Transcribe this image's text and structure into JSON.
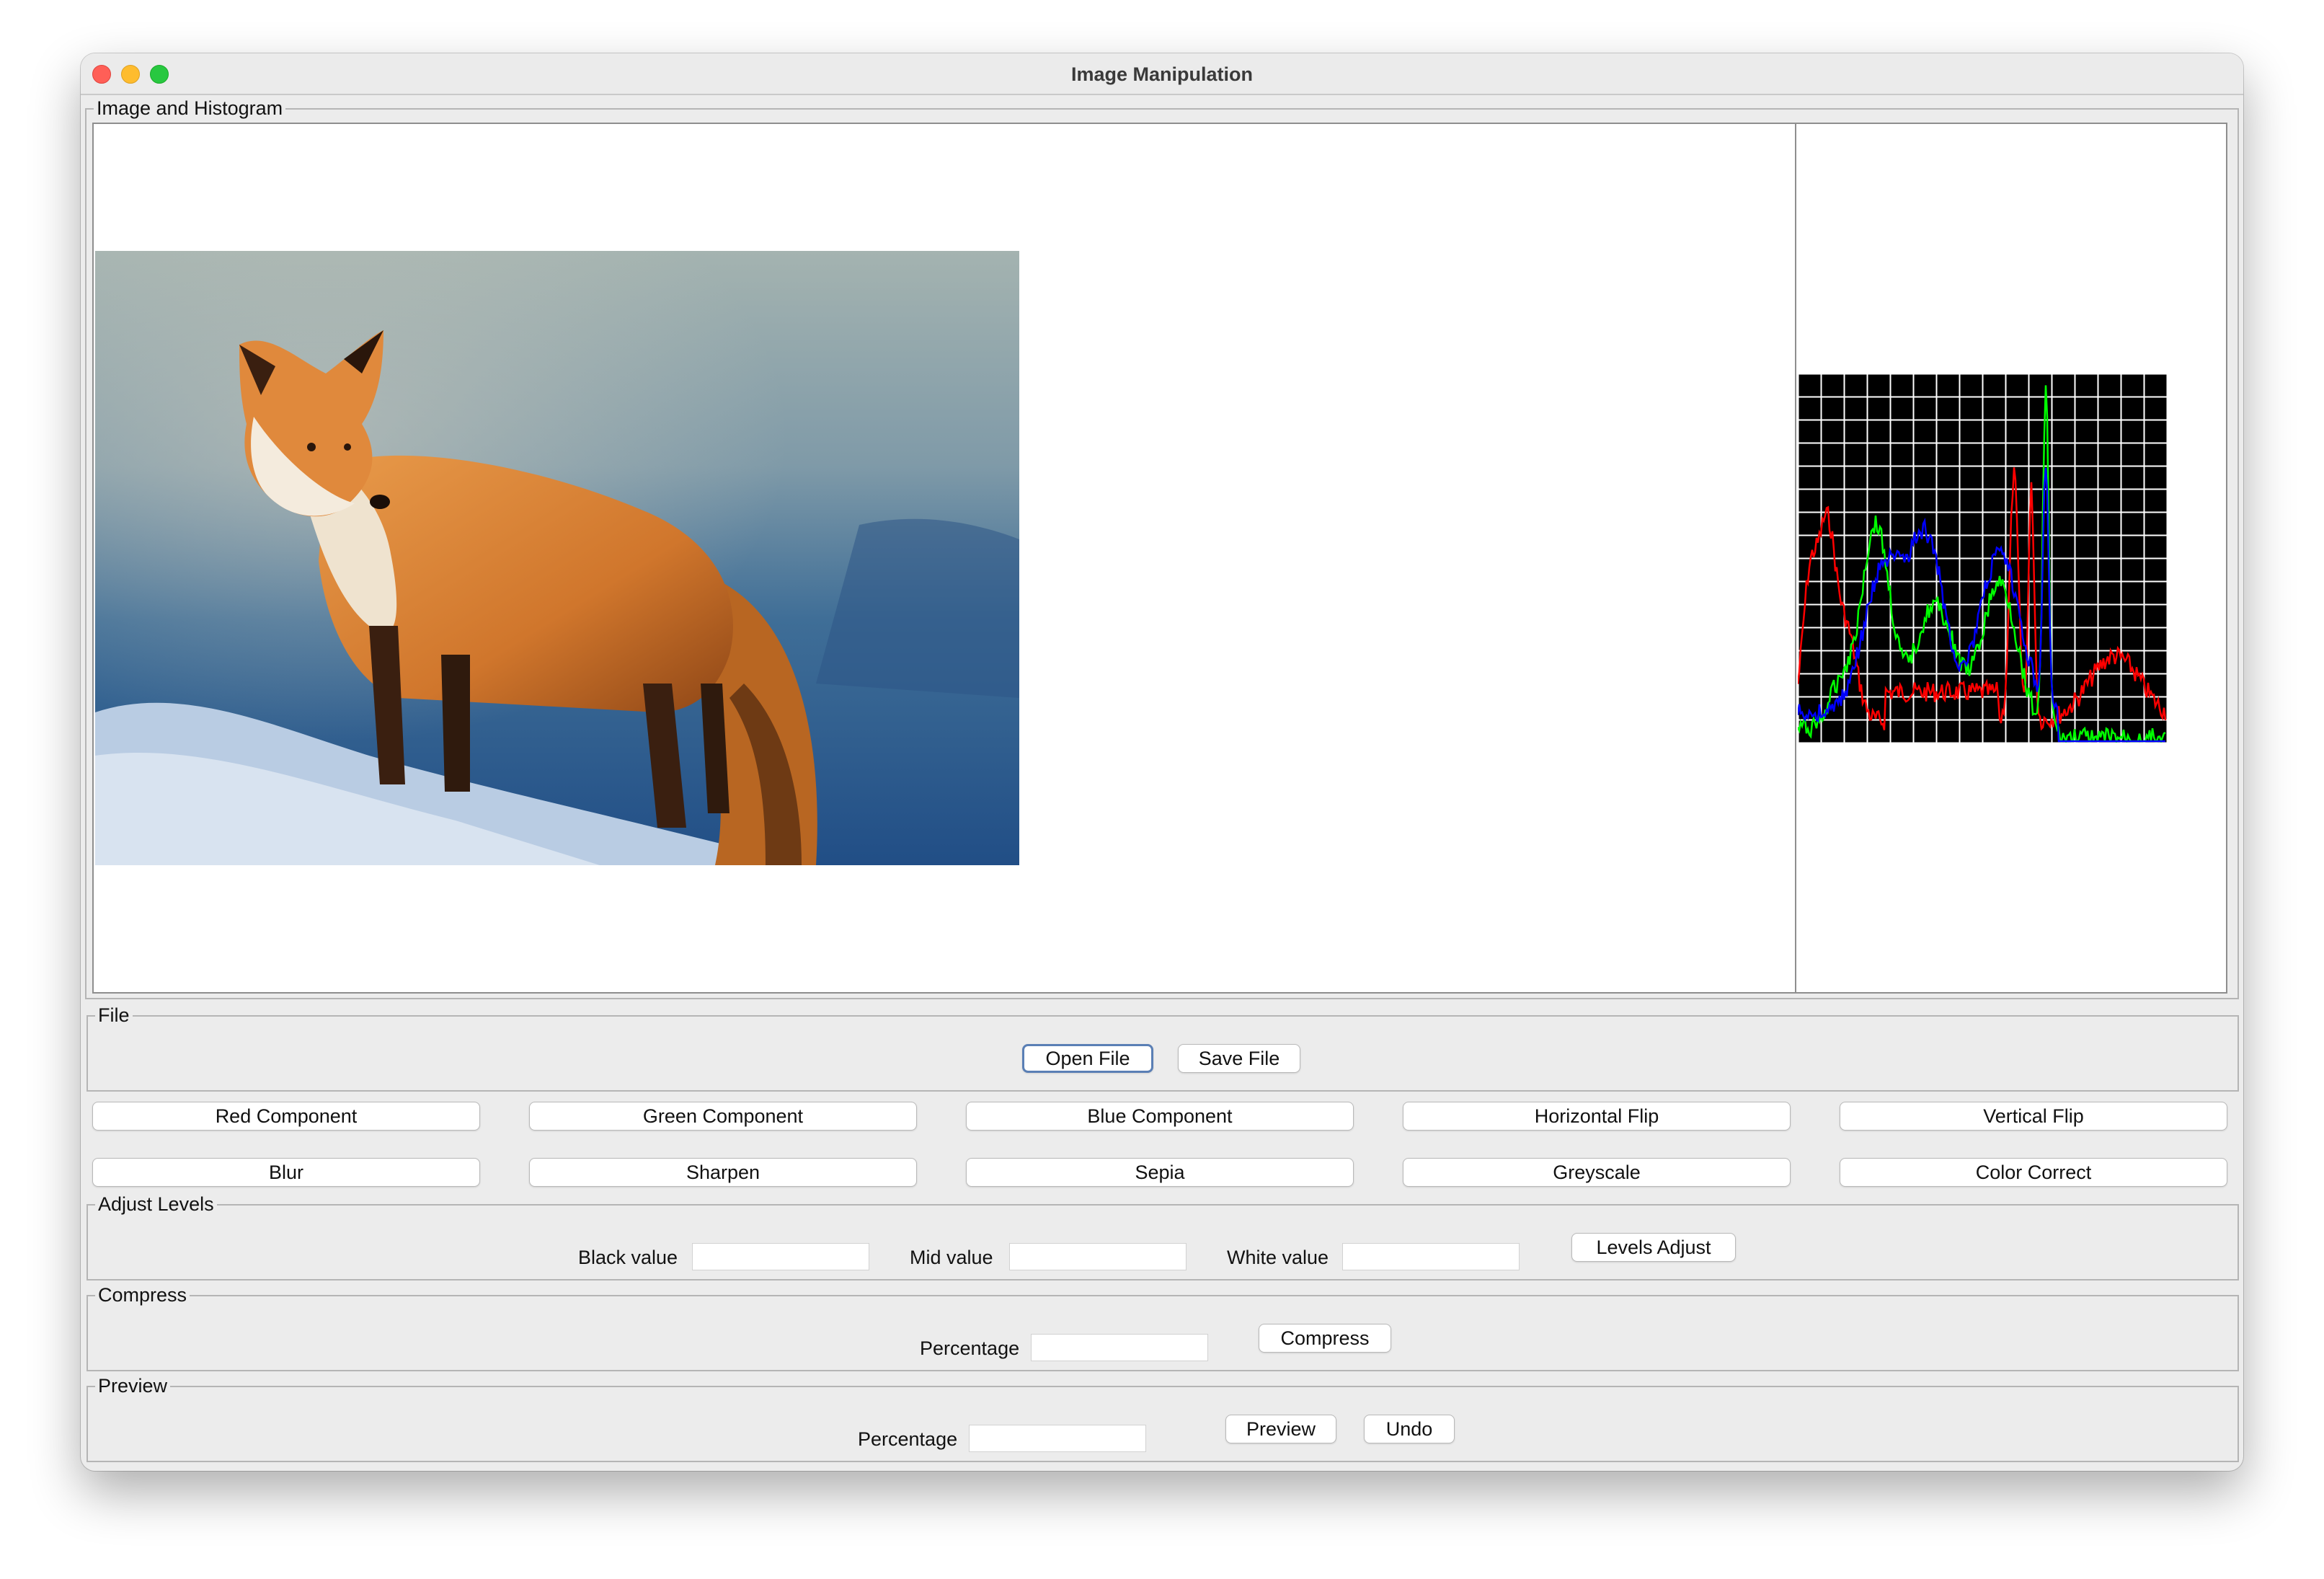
{
  "window": {
    "title": "Image Manipulation"
  },
  "image_panel": {
    "label": "Image and Histogram",
    "image_subject": "red fox standing on snow"
  },
  "histogram": {
    "colors": {
      "red": "#ff0000",
      "green": "#00ff00",
      "blue": "#0000ff",
      "grid": "#ffffff",
      "background": "#000000"
    }
  },
  "file_panel": {
    "label": "File",
    "open_label": "Open File",
    "save_label": "Save File"
  },
  "operations": {
    "row1": [
      "Red Component",
      "Green Component",
      "Blue Component",
      "Horizontal Flip",
      "Vertical Flip"
    ],
    "row2": [
      "Blur",
      "Sharpen",
      "Sepia",
      "Greyscale",
      "Color Correct"
    ]
  },
  "levels": {
    "label": "Adjust Levels",
    "black_label": "Black value",
    "mid_label": "Mid value",
    "white_label": "White value",
    "button_label": "Levels Adjust"
  },
  "compress": {
    "label": "Compress",
    "percentage_label": "Percentage",
    "button_label": "Compress"
  },
  "preview": {
    "label": "Preview",
    "percentage_label": "Percentage",
    "preview_label": "Preview",
    "undo_label": "Undo"
  }
}
